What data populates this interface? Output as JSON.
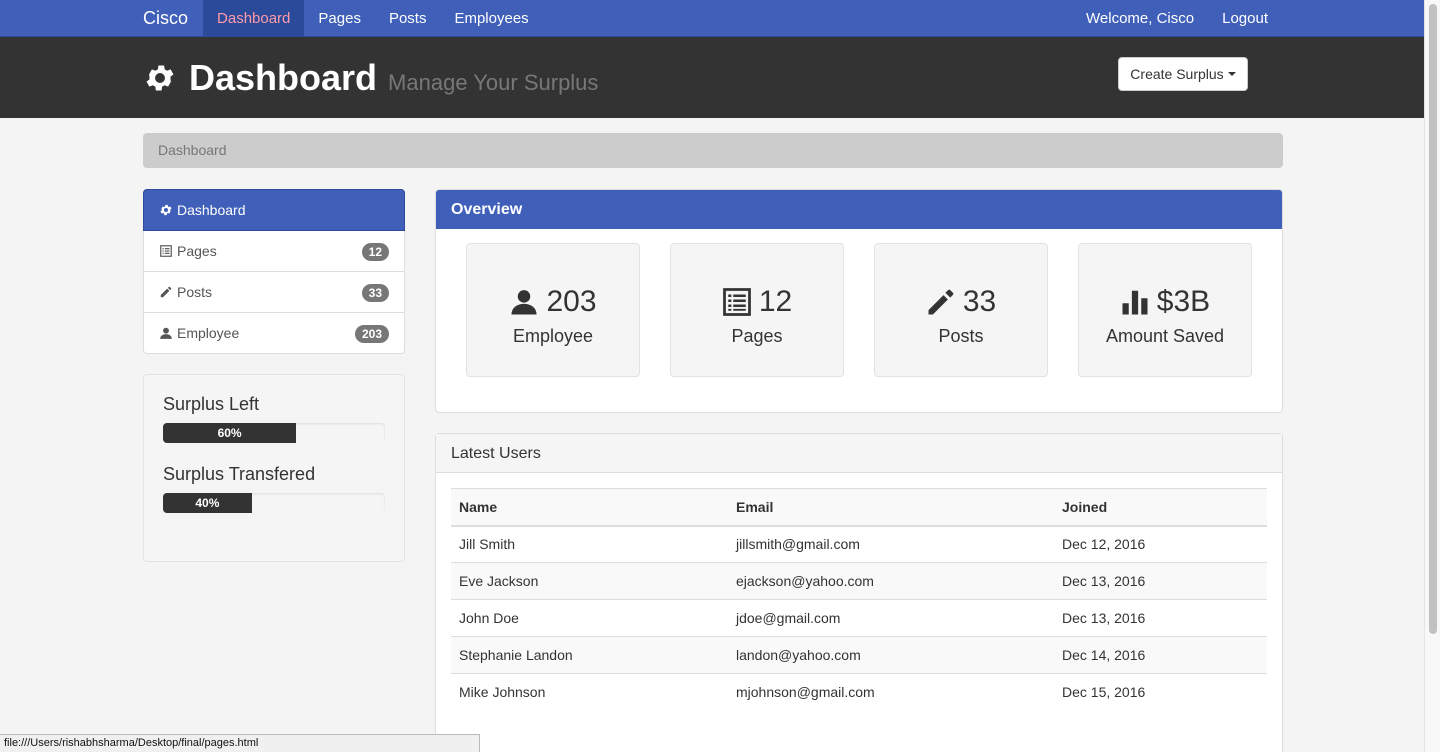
{
  "navbar": {
    "brand": "Cisco",
    "links": [
      "Dashboard",
      "Pages",
      "Posts",
      "Employees"
    ],
    "welcome": "Welcome, Cisco",
    "logout": "Logout"
  },
  "header": {
    "title": "Dashboard",
    "subtitle": "Manage Your Surplus",
    "create_button": "Create Surplus"
  },
  "breadcrumb": "Dashboard",
  "sidebar": {
    "items": [
      {
        "label": "Dashboard",
        "icon": "gear-icon"
      },
      {
        "label": "Pages",
        "icon": "list-icon",
        "badge": "12"
      },
      {
        "label": "Posts",
        "icon": "pencil-icon",
        "badge": "33"
      },
      {
        "label": "Employee",
        "icon": "user-icon",
        "badge": "203"
      }
    ]
  },
  "surplus": {
    "left_title": "Surplus Left",
    "left_value": "60%",
    "left_pct": 60,
    "transferred_title": "Surplus Transfered",
    "transferred_value": "40%",
    "transferred_pct": 40
  },
  "overview": {
    "title": "Overview",
    "stats": [
      {
        "icon": "user-icon",
        "value": "203",
        "label": "Employee"
      },
      {
        "icon": "list-icon",
        "value": "12",
        "label": "Pages"
      },
      {
        "icon": "pencil-icon",
        "value": "33",
        "label": "Posts"
      },
      {
        "icon": "bar-chart-icon",
        "value": "$3B",
        "label": "Amount Saved"
      }
    ]
  },
  "latest_users": {
    "title": "Latest Users",
    "columns": [
      "Name",
      "Email",
      "Joined"
    ],
    "rows": [
      [
        "Jill Smith",
        "jillsmith@gmail.com",
        "Dec 12, 2016"
      ],
      [
        "Eve Jackson",
        "ejackson@yahoo.com",
        "Dec 13, 2016"
      ],
      [
        "John Doe",
        "jdoe@gmail.com",
        "Dec 13, 2016"
      ],
      [
        "Stephanie Landon",
        "landon@yahoo.com",
        "Dec 14, 2016"
      ],
      [
        "Mike Johnson",
        "mjohnson@gmail.com",
        "Dec 15, 2016"
      ]
    ]
  },
  "status_bar": "file:///Users/rishabhsharma/Desktop/final/pages.html",
  "colors": {
    "primary": "#3f5fb9",
    "header_bg": "#333333",
    "active_link": "#ff9aa8"
  }
}
